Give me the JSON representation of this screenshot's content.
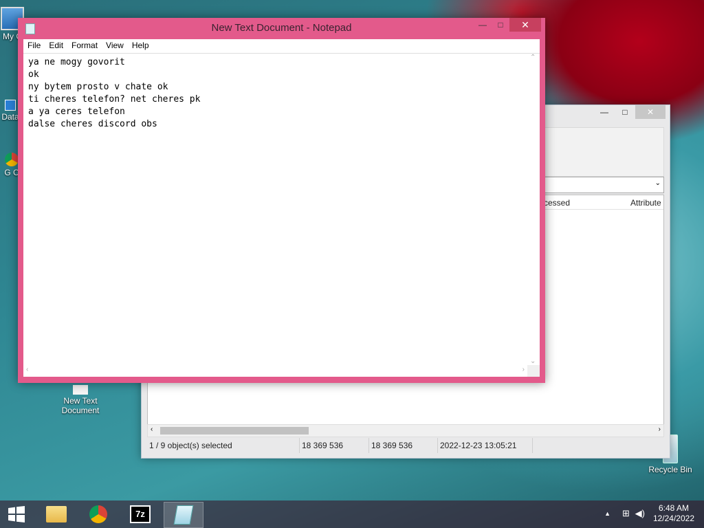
{
  "desktop": {
    "icons": [
      {
        "label": "My C",
        "icon": "computer-icon"
      },
      {
        "label": "Data",
        "icon": "shortcut-icon"
      },
      {
        "label": "G C",
        "icon": "chrome-icon"
      },
      {
        "label": "New Text Document",
        "icon": "text-file-icon"
      },
      {
        "label": "Recycle Bin",
        "icon": "recycle-bin-icon"
      }
    ]
  },
  "notepad": {
    "title": "New Text Document - Notepad",
    "menu": [
      "File",
      "Edit",
      "Format",
      "View",
      "Help"
    ],
    "content": "ya ne mogy govorit\nok\nny bytem prosto v chate ok\nti cheres telefon? net cheres pk\na ya ceres telefon\ndalse cheres discord obs",
    "controls": {
      "minimize": "—",
      "maximize": "□",
      "close": "✕"
    }
  },
  "background_window": {
    "columns": [
      "ccessed",
      "Attribute"
    ],
    "status": {
      "selected": "1 / 9 object(s) selected",
      "size": "18 369 536",
      "packed": "18 369 536",
      "modified": "2022-12-23 13:05:21"
    }
  },
  "taskbar": {
    "apps": [
      "start-icon",
      "file-explorer-icon",
      "chrome-icon",
      "7zip-icon",
      "notepad-icon"
    ],
    "time": "6:48 AM",
    "date": "12/24/2022"
  }
}
